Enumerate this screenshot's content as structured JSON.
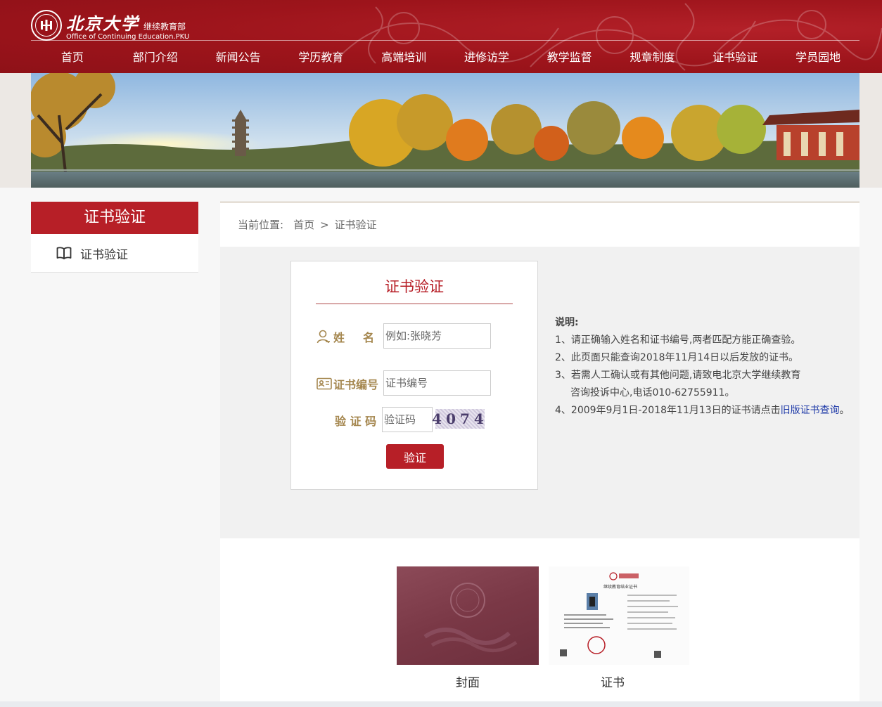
{
  "header": {
    "logo_cn": "北京大学",
    "logo_sub": "继续教育部",
    "logo_en": "Office of Continuing Education.PKU"
  },
  "nav": [
    {
      "label": "首页"
    },
    {
      "label": "部门介绍"
    },
    {
      "label": "新闻公告"
    },
    {
      "label": "学历教育"
    },
    {
      "label": "高端培训"
    },
    {
      "label": "进修访学"
    },
    {
      "label": "教学监督"
    },
    {
      "label": "规章制度"
    },
    {
      "label": "证书验证"
    },
    {
      "label": "学员园地"
    }
  ],
  "sidebar": {
    "title": "证书验证",
    "items": [
      {
        "label": "证书验证",
        "icon": "book-icon"
      }
    ]
  },
  "breadcrumb": {
    "prefix": "当前位置:",
    "home": "首页",
    "separator": ">",
    "current": "证书验证"
  },
  "form": {
    "title": "证书验证",
    "name_label_1": "姓",
    "name_label_2": "名",
    "name_placeholder": "例如:张晓芳",
    "cert_label": "证书编号",
    "cert_placeholder": "证书编号",
    "captcha_label": "验 证 码",
    "captcha_placeholder": "验证码",
    "captcha_code": "4074",
    "submit_label": "验证"
  },
  "notes": {
    "heading": "说明:",
    "lines": [
      "1、请正确输入姓名和证书编号,两者匹配方能正确查验。",
      "2、此页面只能查询2018年11月14日以后发放的证书。",
      "3、若需人工确认或有其他问题,请致电北京大学继续教育",
      "咨询投诉中心,电话010-62755911。",
      "4、2009年9月1日-2018年11月13日的证书请点击"
    ],
    "link_text": "旧版证书查询",
    "link_suffix": "。"
  },
  "samples": {
    "cover_caption": "封面",
    "cert_caption": "证书",
    "cert_header": "继续教育结业证书"
  },
  "colors": {
    "brand_red": "#b71f27",
    "header_red": "#9d141b",
    "label_gold": "#a5874f",
    "link_blue": "#1f3aa8"
  }
}
